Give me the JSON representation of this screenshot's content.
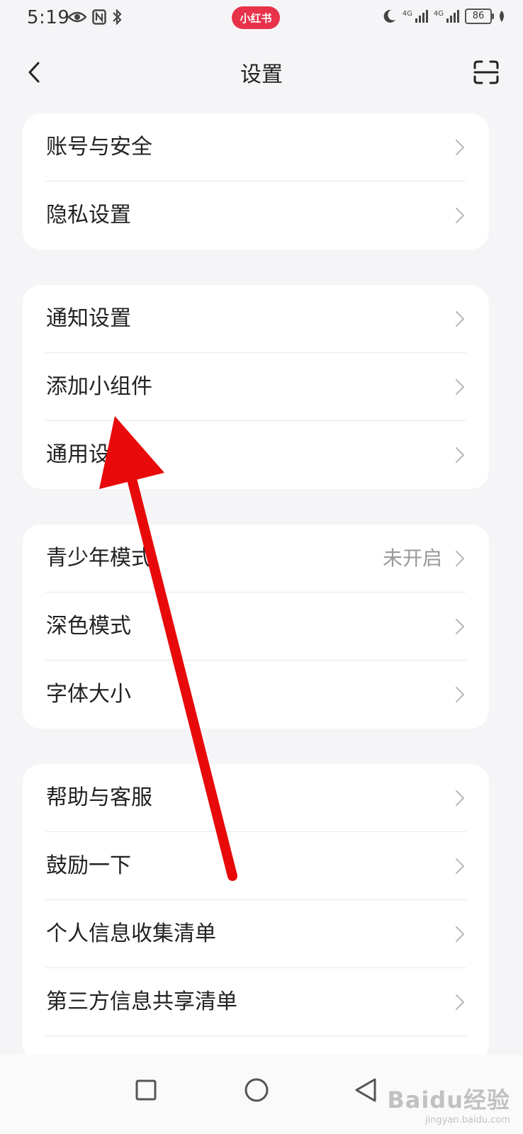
{
  "status_bar": {
    "time": "5:19",
    "battery": "86",
    "network_labels": [
      "4G",
      "4G"
    ]
  },
  "app_badge": "小红书",
  "header": {
    "title": "设置"
  },
  "groups": [
    {
      "items": [
        {
          "label": "账号与安全"
        },
        {
          "label": "隐私设置"
        }
      ]
    },
    {
      "items": [
        {
          "label": "通知设置"
        },
        {
          "label": "添加小组件"
        },
        {
          "label": "通用设置"
        }
      ]
    },
    {
      "items": [
        {
          "label": "青少年模式",
          "value": "未开启"
        },
        {
          "label": "深色模式"
        },
        {
          "label": "字体大小"
        }
      ]
    },
    {
      "items": [
        {
          "label": "帮助与客服"
        },
        {
          "label": "鼓励一下"
        },
        {
          "label": "个人信息收集清单"
        },
        {
          "label": "第三方信息共享清单"
        }
      ]
    }
  ],
  "annotation": {
    "color": "#e80a0a"
  },
  "watermark": {
    "main": "Baidu经验",
    "sub": "jingyan.baidu.com"
  }
}
